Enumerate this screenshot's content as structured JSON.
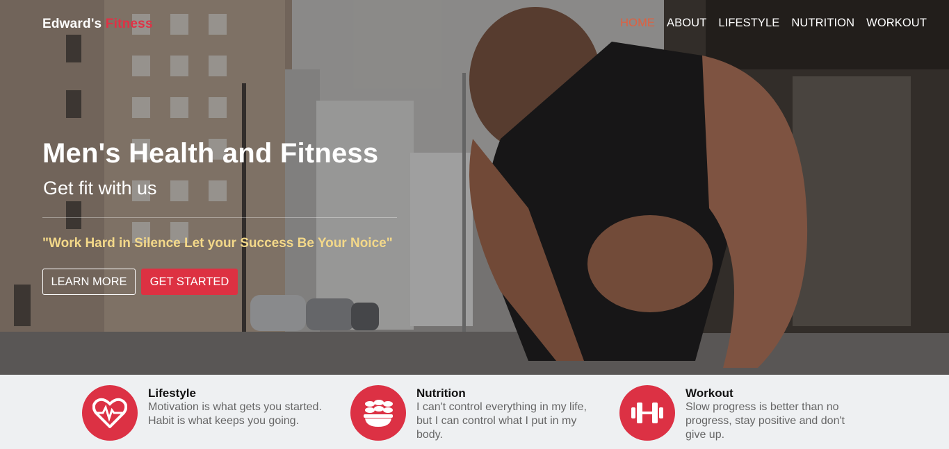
{
  "brand": {
    "name": "Edward's",
    "accent": "Fitness"
  },
  "nav": [
    {
      "label": "HOME",
      "active": true
    },
    {
      "label": "ABOUT",
      "active": false
    },
    {
      "label": "LIFESTYLE",
      "active": false
    },
    {
      "label": "NUTRITION",
      "active": false
    },
    {
      "label": "WORKOUT",
      "active": false
    }
  ],
  "hero": {
    "title": "Men's Health and Fitness",
    "subtitle": "Get fit with us",
    "quote": "\"Work Hard in Silence Let your Success Be Your Noice\"",
    "learn_more": "LEARN MORE",
    "get_started": "GET STARTED"
  },
  "features": [
    {
      "title": "Lifestyle",
      "desc": "Motivation is what gets you started. Habit is what keeps you going.",
      "icon": "heart-pulse-icon"
    },
    {
      "title": "Nutrition",
      "desc": "I can't control everything in my life, but I can control what I put in my body.",
      "icon": "food-bowl-icon"
    },
    {
      "title": "Workout",
      "desc": "Slow progress is better than no progress, stay positive and don't give up.",
      "icon": "dumbbell-icon"
    }
  ],
  "colors": {
    "accent": "#dd3142",
    "active_nav": "#e0603f",
    "quote": "#f3d889",
    "feature_bg": "#eef0f2"
  }
}
